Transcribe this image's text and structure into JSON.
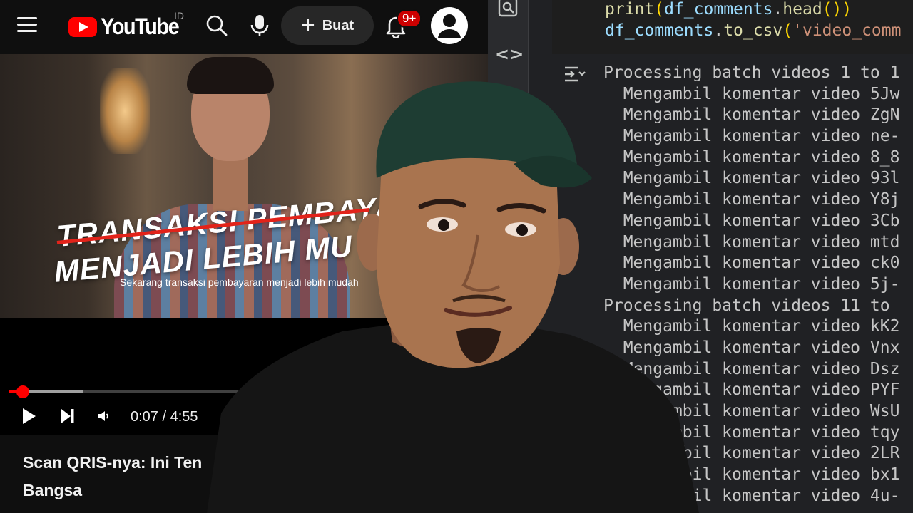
{
  "youtube": {
    "logo_text": "YouTube",
    "country": "ID",
    "create_label": "Buat",
    "notification_count": "9+",
    "video_overlay": {
      "line1": "TRANSAKSI PEMBAYAR",
      "line2": "MENJADI LEBIH MU",
      "caption": "Sekarang transaksi pembayaran menjadi lebih mudah"
    },
    "player": {
      "current_time": "0:07",
      "separator": " / ",
      "duration": "4:55",
      "progress_fraction": 0.03
    },
    "title_line1": "Scan QRIS-nya: Ini Ten",
    "title_line2": "Bangsa"
  },
  "notebook": {
    "code_lines": [
      "print(df_comments.head())",
      "df_comments.to_csv('video_comm"
    ],
    "output_lines": [
      "Processing batch videos 1 to 1",
      "  Mengambil komentar video 5Jw",
      "  Mengambil komentar video ZgN",
      "  Mengambil komentar video ne-",
      "  Mengambil komentar video 8_8",
      "  Mengambil komentar video 93l",
      "  Mengambil komentar video Y8j",
      "  Mengambil komentar video 3Cb",
      "  Mengambil komentar video mtd",
      "  Mengambil komentar video ck0",
      "  Mengambil komentar video 5j-",
      "Processing batch videos 11 to",
      "  Mengambil komentar video kK2",
      "  Mengambil komentar video Vnx",
      "  Mengambil komentar video Dsz",
      "  Mengambil komentar video PYF",
      "  Mengambil komentar video WsU",
      "  Mengambil komentar video tqy",
      "  Mengambil komentar video 2LR",
      "  Mengambil komentar video bx1",
      "  Mengambil komentar video 4u-"
    ]
  },
  "icons": {
    "menu": "hamburger-icon",
    "search": "search-icon",
    "mic": "microphone-icon",
    "bell": "bell-icon",
    "avatar": "account-icon",
    "inspect": "search-inspect-icon",
    "code": "code-brackets-icon",
    "output": "output-collapse-icon"
  },
  "colors": {
    "youtube_red": "#ff0000",
    "badge_red": "#cc0000",
    "yt_bg": "#0f0f0f",
    "notebook_bg": "#202124"
  }
}
